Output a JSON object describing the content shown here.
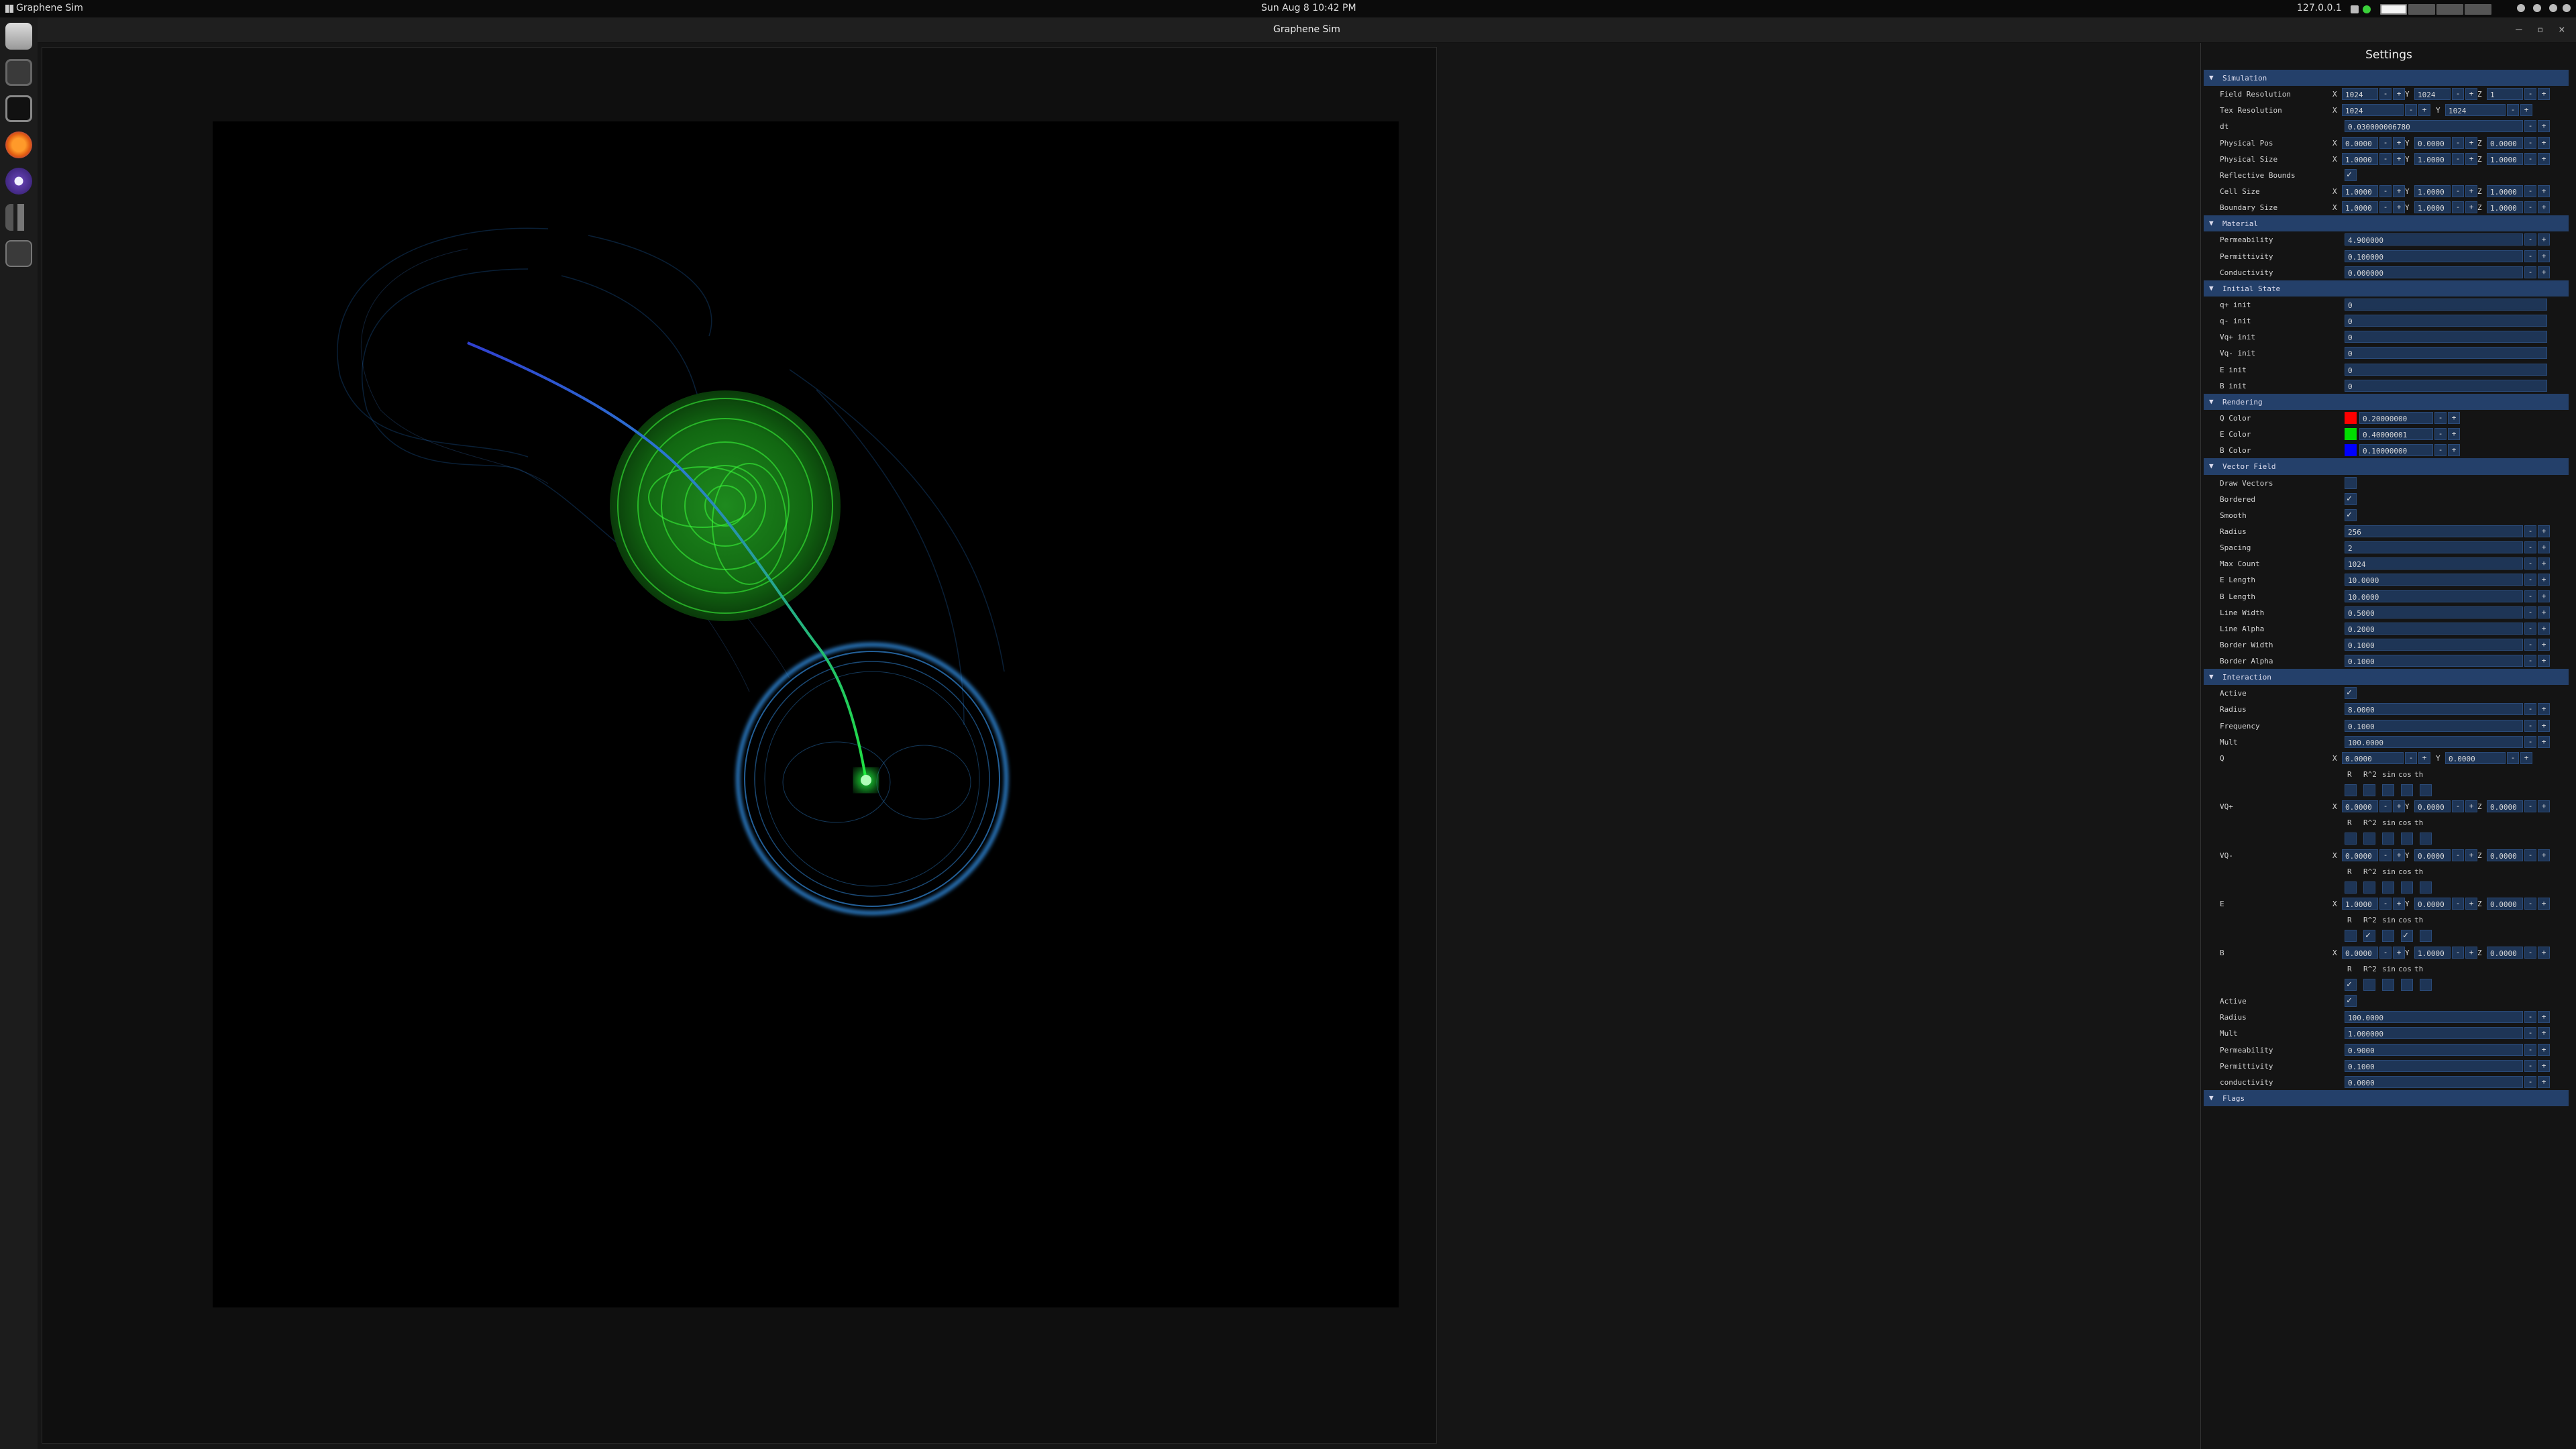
{
  "topbar": {
    "app_name": "Graphene Sim",
    "datetime": "Sun Aug 8  10:42 PM",
    "ip": "127.0.0.1"
  },
  "window": {
    "title": "Graphene Sim",
    "controls": [
      "–",
      "▫",
      "×"
    ]
  },
  "dock": {
    "items": [
      "files-icon",
      "calculator-icon",
      "terminal-icon",
      "firefox-icon",
      "eclipse-icon",
      "chrome-dino-icon",
      "graphene-sim-icon"
    ]
  },
  "settings": {
    "title": "Settings",
    "sections": {
      "simulation": "Simulation",
      "material": "Material",
      "initial_state": "Initial State",
      "rendering": "Rendering",
      "vector_field": "Vector Field",
      "interaction": "Interaction",
      "flags": "Flags"
    },
    "simulation": {
      "field_resolution": {
        "label": "Field Resolution",
        "x": "1024",
        "y": "1024",
        "z": "1"
      },
      "tex_resolution": {
        "label": "Tex Resolution",
        "x": "1024",
        "y": "1024"
      },
      "dt": {
        "label": "dt",
        "value": "0.030000006780"
      },
      "physical_pos": {
        "label": "Physical Pos",
        "x": "0.0000",
        "y": "0.0000",
        "z": "0.0000"
      },
      "physical_size": {
        "label": "Physical Size",
        "x": "1.0000",
        "y": "1.0000",
        "z": "1.0000"
      },
      "reflective_bounds": {
        "label": "Reflective Bounds"
      },
      "cell_size": {
        "label": "Cell Size",
        "x": "1.0000",
        "y": "1.0000",
        "z": "1.0000"
      },
      "boundary_size": {
        "label": "Boundary Size",
        "x": "1.0000",
        "y": "1.0000",
        "z": "1.0000"
      }
    },
    "material": {
      "permeability": {
        "label": "Permeability",
        "value": "4.900000"
      },
      "permittivity": {
        "label": "Permittivity",
        "value": "0.100000"
      },
      "conductivity": {
        "label": "Conductivity",
        "value": "0.000000"
      }
    },
    "initial_state": {
      "q_plus": {
        "label": "q+ init",
        "value": "0"
      },
      "q_minus": {
        "label": "q- init",
        "value": "0"
      },
      "vq_plus": {
        "label": "Vq+ init",
        "value": "0"
      },
      "vq_minus": {
        "label": "Vq- init",
        "value": "0"
      },
      "e_init": {
        "label": "E init",
        "value": "0"
      },
      "b_init": {
        "label": "B init",
        "value": "0"
      }
    },
    "rendering": {
      "q_color": {
        "label": "Q Color",
        "value": "0.20000000",
        "color": "#ff0000"
      },
      "e_color": {
        "label": "E Color",
        "value": "0.40000001",
        "color": "#00dd00"
      },
      "b_color": {
        "label": "B Color",
        "value": "0.10000000",
        "color": "#0000ff"
      }
    },
    "vector_field": {
      "draw_vectors": {
        "label": "Draw Vectors"
      },
      "bordered": {
        "label": "Bordered"
      },
      "smooth": {
        "label": "Smooth"
      },
      "radius": {
        "label": "Radius",
        "value": "256"
      },
      "spacing": {
        "label": "Spacing",
        "value": "2"
      },
      "max_count": {
        "label": "Max Count",
        "value": "1024"
      },
      "e_length": {
        "label": "E Length",
        "value": "10.0000"
      },
      "b_length": {
        "label": "B Length",
        "value": "10.0000"
      },
      "line_width": {
        "label": "Line Width",
        "value": "0.5000"
      },
      "line_alpha": {
        "label": "Line Alpha",
        "value": "0.2000"
      },
      "border_width": {
        "label": "Border Width",
        "value": "0.1000"
      },
      "border_alpha": {
        "label": "Border Alpha",
        "value": "0.1000"
      }
    },
    "interaction": {
      "active": {
        "label": "Active"
      },
      "radius": {
        "label": "Radius",
        "value": "8.0000"
      },
      "frequency": {
        "label": "Frequency",
        "value": "0.1000"
      },
      "mult": {
        "label": "Mult",
        "value": "100.0000"
      },
      "q": {
        "label": "Q",
        "x": "0.0000",
        "y": "0.0000"
      },
      "vq_plus": {
        "label": "VQ+",
        "x": "0.0000",
        "y": "0.0000",
        "z": "0.0000"
      },
      "vq_minus": {
        "label": "VQ-",
        "x": "0.0000",
        "y": "0.0000",
        "z": "0.0000"
      },
      "e": {
        "label": "E",
        "x": "1.0000",
        "y": "0.0000",
        "z": "0.0000"
      },
      "b": {
        "label": "B",
        "x": "0.0000",
        "y": "1.0000",
        "z": "0.0000"
      },
      "fn_labels": {
        "r": "R",
        "r2": "R^2",
        "sin": "sin",
        "cos": "cos",
        "th": "th"
      },
      "active2": {
        "label": "Active"
      },
      "radius2": {
        "label": "Radius",
        "value": "100.0000"
      },
      "mult2": {
        "label": "Mult",
        "value": "1.000000"
      },
      "permeability2": {
        "label": "Permeability",
        "value": "0.9000"
      },
      "permittivity2": {
        "label": "Permittivity",
        "value": "0.1000"
      },
      "conductivity2": {
        "label": "conductivity",
        "value": "0.0000"
      }
    },
    "axis": {
      "x": "X",
      "y": "Y",
      "z": "Z"
    },
    "buttons": {
      "minus": "-",
      "plus": "+"
    }
  }
}
